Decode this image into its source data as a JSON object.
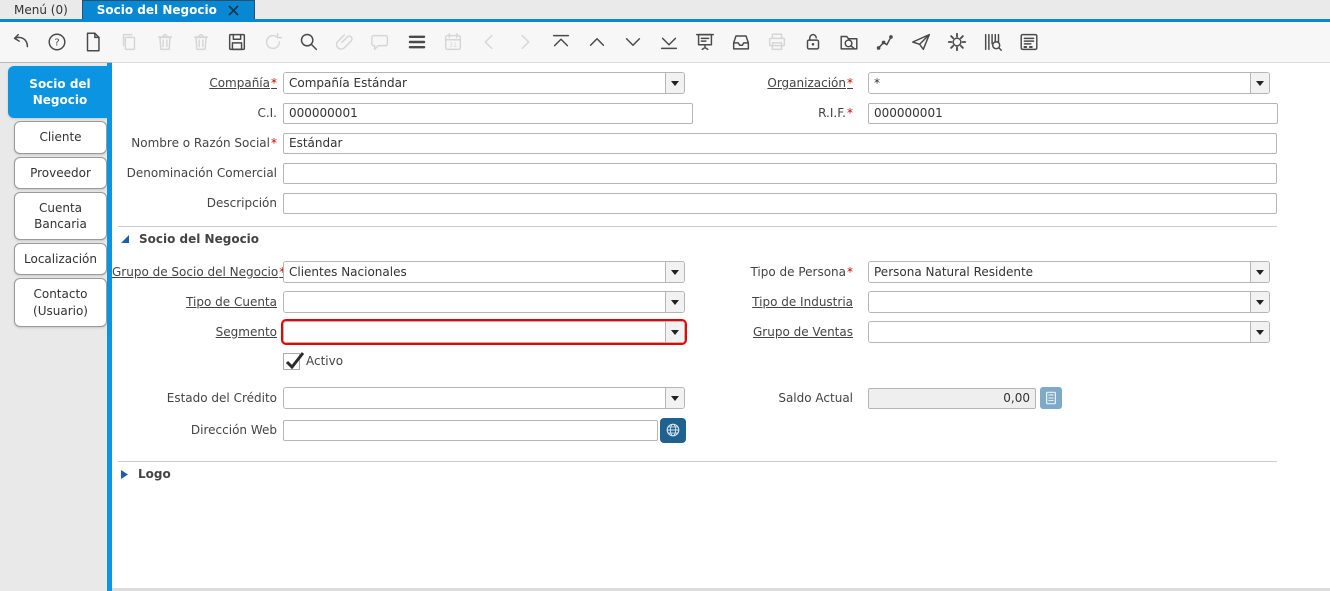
{
  "window_tabs": [
    {
      "label": "Menú (0)",
      "active": false
    },
    {
      "label": "Socio del Negocio",
      "active": true,
      "closable": true
    }
  ],
  "toolbar": {
    "icons": [
      {
        "name": "undo-icon",
        "enabled": true
      },
      {
        "name": "help-icon",
        "enabled": true
      },
      {
        "name": "new-record-icon",
        "enabled": true
      },
      {
        "name": "copy-record-icon",
        "enabled": false
      },
      {
        "name": "delete-record-icon",
        "enabled": false
      },
      {
        "name": "delete-selection-icon",
        "enabled": false
      },
      {
        "name": "save-icon",
        "enabled": true
      },
      {
        "name": "refresh-icon",
        "enabled": false
      },
      {
        "name": "find-icon",
        "enabled": true
      },
      {
        "name": "attachment-icon",
        "enabled": false
      },
      {
        "name": "chat-icon",
        "enabled": false
      },
      {
        "name": "grid-toggle-icon",
        "enabled": true
      },
      {
        "name": "calendar-icon",
        "enabled": false
      },
      {
        "name": "previous-record-icon",
        "enabled": false
      },
      {
        "name": "next-record-icon",
        "enabled": false
      },
      {
        "name": "first-record-icon",
        "enabled": true
      },
      {
        "name": "parent-record-icon",
        "enabled": true
      },
      {
        "name": "detail-record-icon",
        "enabled": true
      },
      {
        "name": "last-record-icon",
        "enabled": true
      },
      {
        "name": "report-icon",
        "enabled": true
      },
      {
        "name": "archive-icon",
        "enabled": true
      },
      {
        "name": "print-icon",
        "enabled": false
      },
      {
        "name": "lock-icon",
        "enabled": true
      },
      {
        "name": "advanced-find-icon",
        "enabled": true
      },
      {
        "name": "workflow-icon",
        "enabled": true
      },
      {
        "name": "share-icon",
        "enabled": true
      },
      {
        "name": "process-icon",
        "enabled": true
      },
      {
        "name": "product-info-icon",
        "enabled": true
      },
      {
        "name": "quick-form-icon",
        "enabled": true
      }
    ]
  },
  "sidebar": {
    "tabs": [
      {
        "label": "Socio del Negocio",
        "active": true
      },
      {
        "label": "Cliente",
        "active": false
      },
      {
        "label": "Proveedor",
        "active": false
      },
      {
        "label": "Cuenta Bancaria",
        "active": false
      },
      {
        "label": "Localización",
        "active": false
      },
      {
        "label": "Contacto (Usuario)",
        "active": false
      }
    ]
  },
  "required_marker": "*",
  "form": {
    "group_headers": {
      "socio": "Socio del Negocio",
      "logo": "Logo"
    },
    "fields": {
      "compania": {
        "label": "Compañía",
        "value": "Compañía Estándar",
        "required": true,
        "type": "combo",
        "link": true
      },
      "organizacion": {
        "label": "Organización",
        "value": "*",
        "required": true,
        "type": "combo",
        "link": true
      },
      "ci": {
        "label": "C.I.",
        "value": "000000001",
        "type": "text"
      },
      "rif": {
        "label": "R.I.F.",
        "value": "000000001",
        "required": true,
        "type": "text"
      },
      "nombre": {
        "label": "Nombre o Razón Social",
        "value": "Estándar",
        "required": true,
        "type": "text"
      },
      "denominacion": {
        "label": "Denominación Comercial",
        "value": "",
        "type": "text"
      },
      "descripcion": {
        "label": "Descripción",
        "value": "",
        "type": "text"
      },
      "grupo_socio": {
        "label": "Grupo de Socio del Negocio",
        "value": "Clientes Nacionales",
        "required": true,
        "type": "combo",
        "link": true
      },
      "tipo_persona": {
        "label": "Tipo de Persona",
        "value": "Persona Natural Residente",
        "required": true,
        "type": "combo"
      },
      "tipo_cuenta": {
        "label": "Tipo de Cuenta",
        "value": "",
        "type": "combo",
        "link": true
      },
      "tipo_industria": {
        "label": "Tipo de Industria",
        "value": "",
        "type": "combo",
        "link": true
      },
      "segmento": {
        "label": "Segmento",
        "value": "",
        "type": "combo",
        "link": true,
        "highlighted": true
      },
      "grupo_ventas": {
        "label": "Grupo de Ventas",
        "value": "",
        "type": "combo",
        "link": true
      },
      "activo": {
        "label": "Activo",
        "checked": true,
        "type": "checkbox"
      },
      "estado_credito": {
        "label": "Estado del Crédito",
        "value": "",
        "type": "combo"
      },
      "saldo_actual": {
        "label": "Saldo Actual",
        "value": "0,00",
        "readonly": true,
        "type": "amount"
      },
      "direccion_web": {
        "label": "Dirección Web",
        "value": "",
        "type": "url"
      }
    }
  },
  "colors": {
    "accent_tab_blue": "#0887d2",
    "sidebar_blue": "#0a94e2",
    "highlight_red": "#ee0000",
    "required_red": "#cc0000",
    "url_button_blue": "#20618f",
    "calc_button_blue": "#7fa9c8",
    "readonly_gray": "#efefef"
  }
}
